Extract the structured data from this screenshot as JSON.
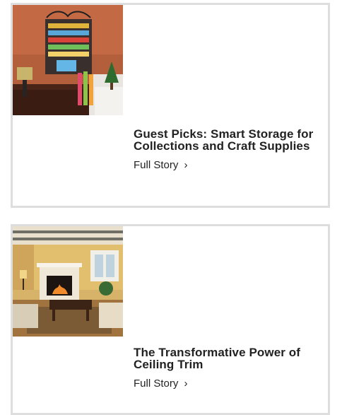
{
  "cards": [
    {
      "title": "Guest Picks: Smart Storage for Collections and Craft Supplies",
      "link_label": "Full Story",
      "link_icon": "chevron-right-icon",
      "image_subject": "craft room with wall-mounted wrapping paper rack"
    },
    {
      "title": "The Transformative Power of Ceiling Trim",
      "link_label": "Full Story",
      "link_icon": "chevron-right-icon",
      "image_subject": "living room with fireplace and beamed ceiling"
    }
  ],
  "colors": {
    "card_border": "#dedede",
    "text": "#222222",
    "background": "#ffffff"
  }
}
